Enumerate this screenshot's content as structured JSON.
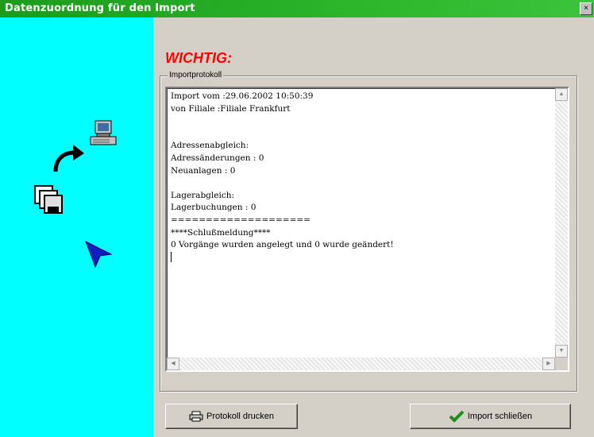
{
  "window": {
    "title": "Datenzuordnung für den Import",
    "close_icon": "close-icon"
  },
  "header": {
    "warning": "WICHTIG:"
  },
  "protocol": {
    "group_label": "Importprotokoll",
    "lines": [
      "Import vom :29.06.2002 10:50:39",
      "von Filiale :Filiale Frankfurt",
      "",
      "",
      "Adressenabgleich:",
      "Adressänderungen : 0",
      "Neuanlagen : 0",
      "",
      "Lagerabgleich:",
      "Lagerbuchungen : 0",
      "====================",
      "****Schlußmeldung****",
      "0 Vorgänge wurden angelegt und 0 wurde geändert!"
    ]
  },
  "buttons": {
    "print_label": "Protokoll drucken",
    "print_icon": "printer-icon",
    "close_label": "Import schließen",
    "close_icon": "checkmark-icon"
  },
  "colors": {
    "titlebar": "#1c9b1c",
    "side_panel": "#00ffff",
    "warning": "#ff0000",
    "checkmark": "#1e8c1e"
  }
}
